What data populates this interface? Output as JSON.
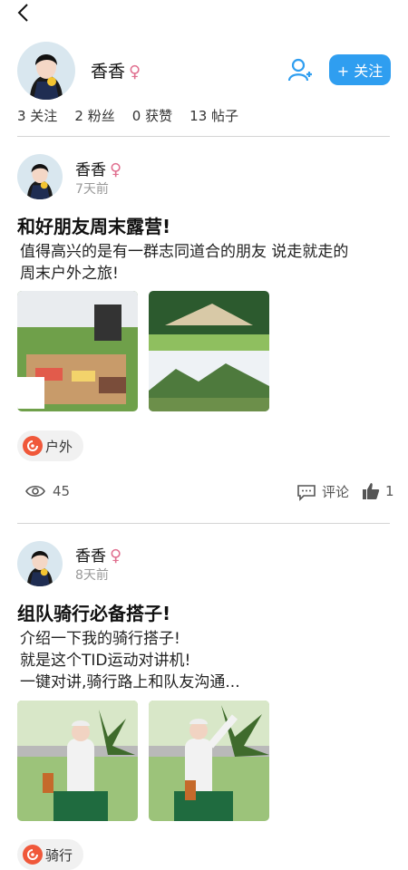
{
  "profile": {
    "name": "香香",
    "gender_symbol": "♀",
    "follow_label": "+ 关注"
  },
  "stats": [
    "3 关注",
    "2 粉丝",
    "0 获赞",
    "13 帖子"
  ],
  "posts": [
    {
      "author": "香香",
      "gender_symbol": "♀",
      "time": "7天前",
      "title": "和好朋友周末露营!",
      "body": "值得高兴的是有一群志同道合的朋友 说走就走的\n周末户外之旅!",
      "tag": "户外",
      "views": "45",
      "comment_label": "评论",
      "likes": "1"
    },
    {
      "author": "香香",
      "gender_symbol": "♀",
      "time": "8天前",
      "title": "组队骑行必备搭子!",
      "body": "介绍一下我的骑行搭子!\n就是这个TID运动对讲机!\n一键对讲,骑行路上和队友沟通...",
      "tag": "骑行"
    }
  ],
  "colors": {
    "accent": "#2f9ef0",
    "gender": "#e06f8f",
    "tag_icon": "#f0583a"
  }
}
